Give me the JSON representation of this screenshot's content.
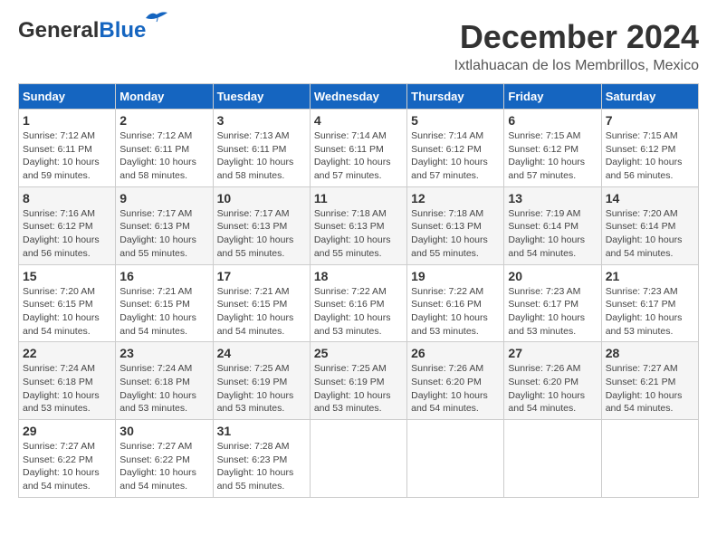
{
  "logo": {
    "general": "General",
    "blue": "Blue"
  },
  "header": {
    "month": "December 2024",
    "location": "Ixtlahuacan de los Membrillos, Mexico"
  },
  "weekdays": [
    "Sunday",
    "Monday",
    "Tuesday",
    "Wednesday",
    "Thursday",
    "Friday",
    "Saturday"
  ],
  "weeks": [
    [
      {
        "day": "1",
        "sunrise": "7:12 AM",
        "sunset": "6:11 PM",
        "daylight": "10 hours and 59 minutes."
      },
      {
        "day": "2",
        "sunrise": "7:12 AM",
        "sunset": "6:11 PM",
        "daylight": "10 hours and 58 minutes."
      },
      {
        "day": "3",
        "sunrise": "7:13 AM",
        "sunset": "6:11 PM",
        "daylight": "10 hours and 58 minutes."
      },
      {
        "day": "4",
        "sunrise": "7:14 AM",
        "sunset": "6:11 PM",
        "daylight": "10 hours and 57 minutes."
      },
      {
        "day": "5",
        "sunrise": "7:14 AM",
        "sunset": "6:12 PM",
        "daylight": "10 hours and 57 minutes."
      },
      {
        "day": "6",
        "sunrise": "7:15 AM",
        "sunset": "6:12 PM",
        "daylight": "10 hours and 57 minutes."
      },
      {
        "day": "7",
        "sunrise": "7:15 AM",
        "sunset": "6:12 PM",
        "daylight": "10 hours and 56 minutes."
      }
    ],
    [
      {
        "day": "8",
        "sunrise": "7:16 AM",
        "sunset": "6:12 PM",
        "daylight": "10 hours and 56 minutes."
      },
      {
        "day": "9",
        "sunrise": "7:17 AM",
        "sunset": "6:13 PM",
        "daylight": "10 hours and 55 minutes."
      },
      {
        "day": "10",
        "sunrise": "7:17 AM",
        "sunset": "6:13 PM",
        "daylight": "10 hours and 55 minutes."
      },
      {
        "day": "11",
        "sunrise": "7:18 AM",
        "sunset": "6:13 PM",
        "daylight": "10 hours and 55 minutes."
      },
      {
        "day": "12",
        "sunrise": "7:18 AM",
        "sunset": "6:13 PM",
        "daylight": "10 hours and 55 minutes."
      },
      {
        "day": "13",
        "sunrise": "7:19 AM",
        "sunset": "6:14 PM",
        "daylight": "10 hours and 54 minutes."
      },
      {
        "day": "14",
        "sunrise": "7:20 AM",
        "sunset": "6:14 PM",
        "daylight": "10 hours and 54 minutes."
      }
    ],
    [
      {
        "day": "15",
        "sunrise": "7:20 AM",
        "sunset": "6:15 PM",
        "daylight": "10 hours and 54 minutes."
      },
      {
        "day": "16",
        "sunrise": "7:21 AM",
        "sunset": "6:15 PM",
        "daylight": "10 hours and 54 minutes."
      },
      {
        "day": "17",
        "sunrise": "7:21 AM",
        "sunset": "6:15 PM",
        "daylight": "10 hours and 54 minutes."
      },
      {
        "day": "18",
        "sunrise": "7:22 AM",
        "sunset": "6:16 PM",
        "daylight": "10 hours and 53 minutes."
      },
      {
        "day": "19",
        "sunrise": "7:22 AM",
        "sunset": "6:16 PM",
        "daylight": "10 hours and 53 minutes."
      },
      {
        "day": "20",
        "sunrise": "7:23 AM",
        "sunset": "6:17 PM",
        "daylight": "10 hours and 53 minutes."
      },
      {
        "day": "21",
        "sunrise": "7:23 AM",
        "sunset": "6:17 PM",
        "daylight": "10 hours and 53 minutes."
      }
    ],
    [
      {
        "day": "22",
        "sunrise": "7:24 AM",
        "sunset": "6:18 PM",
        "daylight": "10 hours and 53 minutes."
      },
      {
        "day": "23",
        "sunrise": "7:24 AM",
        "sunset": "6:18 PM",
        "daylight": "10 hours and 53 minutes."
      },
      {
        "day": "24",
        "sunrise": "7:25 AM",
        "sunset": "6:19 PM",
        "daylight": "10 hours and 53 minutes."
      },
      {
        "day": "25",
        "sunrise": "7:25 AM",
        "sunset": "6:19 PM",
        "daylight": "10 hours and 53 minutes."
      },
      {
        "day": "26",
        "sunrise": "7:26 AM",
        "sunset": "6:20 PM",
        "daylight": "10 hours and 54 minutes."
      },
      {
        "day": "27",
        "sunrise": "7:26 AM",
        "sunset": "6:20 PM",
        "daylight": "10 hours and 54 minutes."
      },
      {
        "day": "28",
        "sunrise": "7:27 AM",
        "sunset": "6:21 PM",
        "daylight": "10 hours and 54 minutes."
      }
    ],
    [
      {
        "day": "29",
        "sunrise": "7:27 AM",
        "sunset": "6:22 PM",
        "daylight": "10 hours and 54 minutes."
      },
      {
        "day": "30",
        "sunrise": "7:27 AM",
        "sunset": "6:22 PM",
        "daylight": "10 hours and 54 minutes."
      },
      {
        "day": "31",
        "sunrise": "7:28 AM",
        "sunset": "6:23 PM",
        "daylight": "10 hours and 55 minutes."
      },
      null,
      null,
      null,
      null
    ]
  ],
  "labels": {
    "sunrise": "Sunrise:",
    "sunset": "Sunset:",
    "daylight": "Daylight:"
  }
}
